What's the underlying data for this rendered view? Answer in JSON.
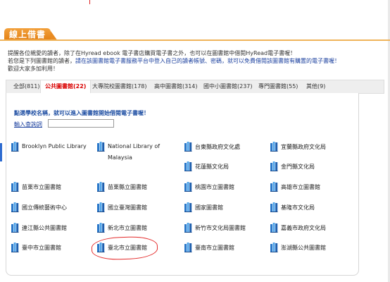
{
  "header": {
    "title": "線上借書"
  },
  "intro": {
    "line1": "提醒各位親愛的讀者，除了在Hyread ebook 電子書店購買電子書之外，也可以在圖書館中借閱HyRead電子書喔！",
    "line2_prefix": "若您是下列圖書館的讀者，",
    "line2_link": "請在該圖書館電子書服務平台中登入自己的讀者帳號、密碼，就可以免費借閱該圖書館有購置的電子書喔！",
    "line3": "歡迎大家多加利用！"
  },
  "tabs": [
    {
      "label": "全部(811)"
    },
    {
      "label": "公共圖書館(22)",
      "active": true
    },
    {
      "label": "大專院校圖書館(178)"
    },
    {
      "label": "高中圖書館(314)"
    },
    {
      "label": "國中小圖書館(237)"
    },
    {
      "label": "專門圖書館(55)"
    },
    {
      "label": "其他(9)"
    }
  ],
  "panel": {
    "prompt": "點選學校名稱，就可以進入圖書館開始借閱電子書喔！",
    "search_label": "輸入查詢詞",
    "search_value": ""
  },
  "libraries": [
    {
      "name": "Brooklyn Public Library"
    },
    {
      "name": "National Library of Malaysia"
    },
    {
      "name": "台東縣政府文化處"
    },
    {
      "name": "宜蘭縣政府文化局"
    },
    {
      "name": "花蓮縣文化局"
    },
    {
      "name": "金門縣文化局"
    },
    {
      "name": "苗栗市立圖書館"
    },
    {
      "name": "苗栗縣立圖書館"
    },
    {
      "name": "桃園市立圖書館"
    },
    {
      "name": "高雄市立圖書館"
    },
    {
      "name": "國立傳統藝術中心"
    },
    {
      "name": "國立臺灣圖書館"
    },
    {
      "name": "國家圖書館"
    },
    {
      "name": "基隆市文化局"
    },
    {
      "name": "連江縣公共圖書館"
    },
    {
      "name": "新北市立圖書館"
    },
    {
      "name": "新竹市文化局圖書館"
    },
    {
      "name": "嘉義市政府文化局"
    },
    {
      "name": "臺中市立圖書館"
    },
    {
      "name": "臺北市立圖書館"
    },
    {
      "name": "臺南市立圖書館"
    },
    {
      "name": "澎湖縣公共圖書館"
    }
  ],
  "icons": {
    "library": "library-books-icon"
  },
  "colors": {
    "accent": "#e98b22",
    "active_tab": "#d90000",
    "link": "#1a3f9e",
    "annotation": "#e42b2b"
  }
}
